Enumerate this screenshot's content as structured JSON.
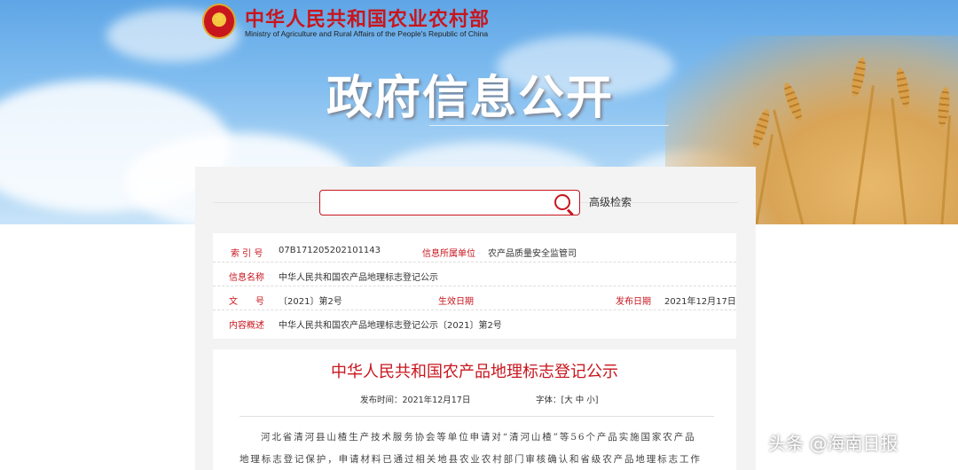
{
  "header": {
    "site_title": "中华人民共和国农业农村部",
    "site_subtitle": "Ministry of Agriculture and Rural Affairs of the People's Republic of China",
    "page_heading": "政府信息公开"
  },
  "search": {
    "placeholder": "",
    "advanced_label": "高级检索"
  },
  "meta": {
    "index_label": "索 引 号",
    "index_value": "07B171205202101143",
    "dept_label": "信息所属单位",
    "dept_value": "农产品质量安全监管司",
    "name_label": "信息名称",
    "name_value": "中华人民共和国农产品地理标志登记公示",
    "doc_label": "文　　号",
    "doc_value": "〔2021〕第2号",
    "effective_label": "生效日期",
    "effective_value": "",
    "publish_label": "发布日期",
    "publish_value": "2021年12月17日",
    "summary_label": "内容概述",
    "summary_value": "中华人民共和国农产品地理标志登记公示〔2021〕第2号"
  },
  "article": {
    "title": "中华人民共和国农产品地理标志登记公示",
    "publish_time": "发布时间：2021年12月17日",
    "font_size": "字体：[大 中 小]",
    "paragraph_line1": "河北省清河县山楂生产技术服务协会等单位申请对“清河山楂”等56个产品实施国家农产品",
    "paragraph_line2": "地理标志登记保护，申请材料已通过相关地县农业农村部门审核确认和省级农产品地理标志工作"
  },
  "watermark": "头条 @海南日报",
  "colors": {
    "accent": "#c8161e",
    "sky": "#7fbcef",
    "panel_bg": "#f3f3f3"
  }
}
